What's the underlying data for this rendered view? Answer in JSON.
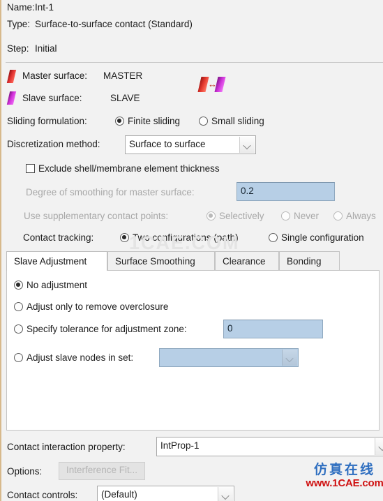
{
  "header": {
    "name_label": "Name:",
    "name_value": "Int-1",
    "type_label": "Type:",
    "type_value": "Surface-to-surface contact (Standard)",
    "step_label": "Step:",
    "step_value": "Initial"
  },
  "surfaces": {
    "master_label": "Master surface:",
    "master_value": "MASTER",
    "slave_label": "Slave surface:",
    "slave_value": "SLAVE",
    "swap_icon": "swap-surfaces-icon",
    "master_icon": "master-surface-icon",
    "slave_icon": "slave-surface-icon",
    "master_color": "#e03030",
    "slave_color": "#d02fd8"
  },
  "sliding": {
    "label": "Sliding formulation:",
    "options": [
      "Finite sliding",
      "Small sliding"
    ],
    "selected": "Finite sliding"
  },
  "discretization": {
    "label": "Discretization method:",
    "value": "Surface to surface"
  },
  "exclude_thickness": {
    "label": "Exclude shell/membrane element thickness",
    "checked": false
  },
  "smoothing": {
    "label": "Degree of smoothing for master surface:",
    "value": "0.2",
    "enabled": false
  },
  "supplementary": {
    "label": "Use supplementary contact points:",
    "options": [
      "Selectively",
      "Never",
      "Always"
    ],
    "selected": "Selectively",
    "enabled": false
  },
  "tracking": {
    "label": "Contact tracking:",
    "options": [
      "Two configurations (path)",
      "Single configuration"
    ],
    "selected": "Two configurations (path)"
  },
  "tabs": [
    {
      "label": "Slave Adjustment",
      "active": true
    },
    {
      "label": "Surface Smoothing",
      "active": false
    },
    {
      "label": "Clearance",
      "active": false
    },
    {
      "label": "Bonding",
      "active": false
    }
  ],
  "slave_adjustment": {
    "options": [
      {
        "label": "No adjustment",
        "selected": true
      },
      {
        "label": "Adjust only to remove overclosure",
        "selected": false
      },
      {
        "label": "Specify tolerance for adjustment zone:",
        "selected": false
      },
      {
        "label": "Adjust slave nodes in set:",
        "selected": false
      }
    ],
    "tolerance_value": "0",
    "node_set_value": ""
  },
  "footer": {
    "interaction_property_label": "Contact interaction property:",
    "interaction_property_value": "IntProp-1",
    "options_label": "Options:",
    "interference_fit_button": "Interference Fit...",
    "contact_controls_label": "Contact controls:",
    "contact_controls_value": "(Default)"
  },
  "watermark": {
    "faint": "1CAE.COM",
    "chinese": "仿真在线",
    "url": "www.1CAE.com",
    "chinese_color": "#2f6fc0",
    "url_color": "#cf1111"
  }
}
